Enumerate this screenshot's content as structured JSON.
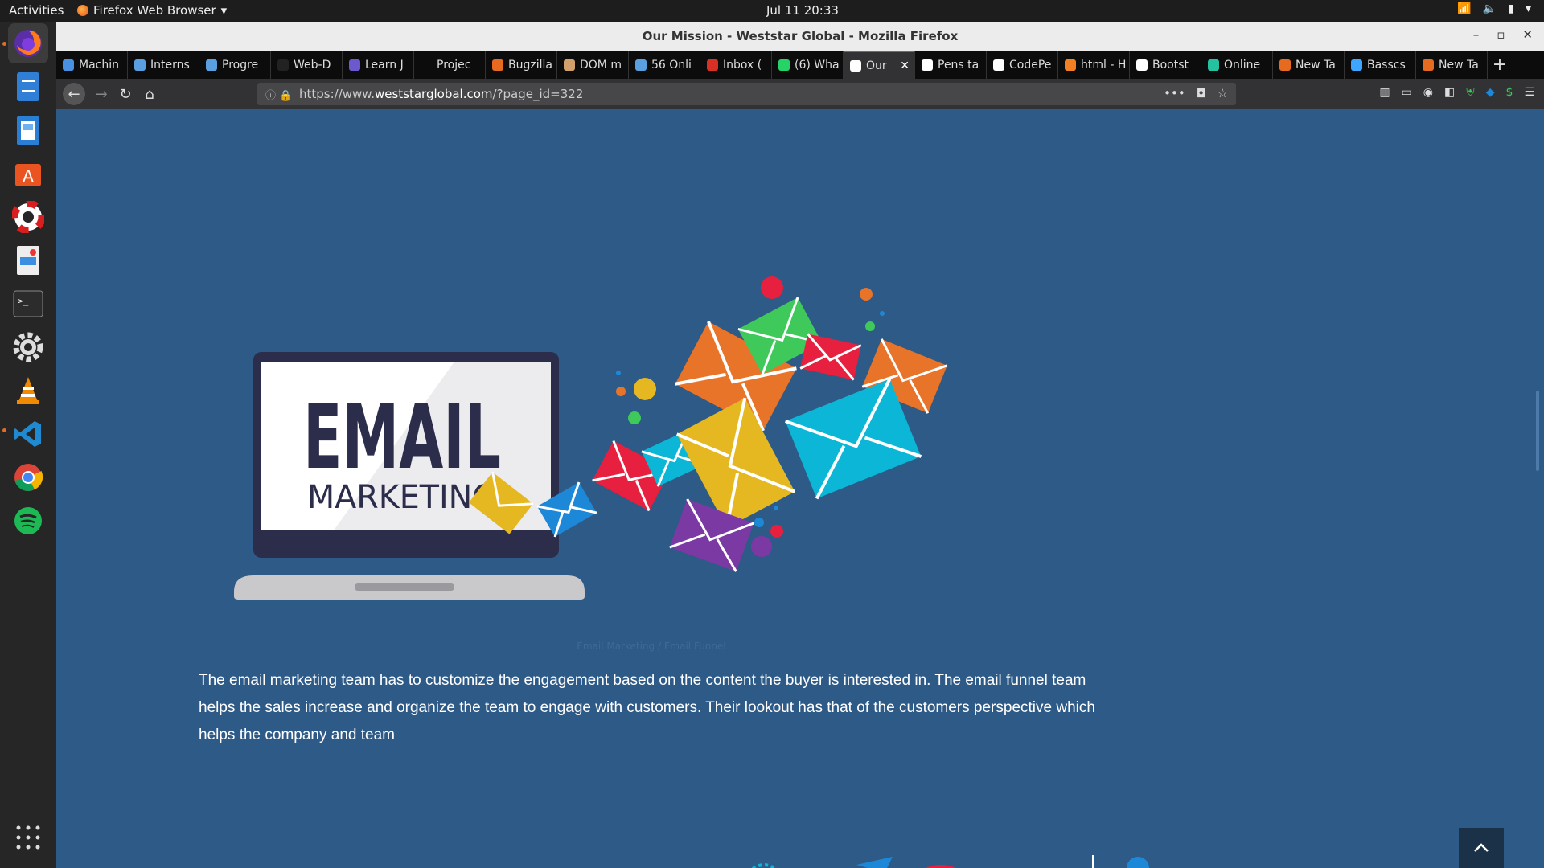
{
  "system": {
    "activities": "Activities",
    "app_name": "Firefox Web Browser",
    "clock": "Jul 11  20:33"
  },
  "window": {
    "title": "Our Mission - Weststar Global - Mozilla Firefox"
  },
  "tabs": [
    {
      "label": "Machin",
      "color": "#4a90e2"
    },
    {
      "label": "Interns",
      "color": "#5aa0e0"
    },
    {
      "label": "Progre",
      "color": "#5aa0e0"
    },
    {
      "label": "Web-D",
      "color": "#222222"
    },
    {
      "label": "Learn J",
      "color": "#6a5acd"
    },
    {
      "label": "Projec",
      "color": "#0c0c0d"
    },
    {
      "label": "Bugzilla",
      "color": "#e66a1f"
    },
    {
      "label": "DOM m",
      "color": "#d2a06a"
    },
    {
      "label": "56 Onli",
      "color": "#5aa0e0"
    },
    {
      "label": "Inbox (",
      "color": "#d93025"
    },
    {
      "label": "(6) Wha",
      "color": "#25d366"
    },
    {
      "label": "Our",
      "color": "#ffffff",
      "active": true
    },
    {
      "label": "Pens ta",
      "color": "#ffffff"
    },
    {
      "label": "CodePe",
      "color": "#ffffff"
    },
    {
      "label": "html - H",
      "color": "#f48024"
    },
    {
      "label": "Bootst",
      "color": "#ffffff"
    },
    {
      "label": "Online",
      "color": "#25c2a0"
    },
    {
      "label": "New Ta",
      "color": "#e66a1f"
    },
    {
      "label": "Basscs",
      "color": "#3ea6ff"
    },
    {
      "label": "New Ta",
      "color": "#e66a1f"
    }
  ],
  "url": {
    "prefix": "https://www.",
    "domain": "weststarglobal.com",
    "suffix": "/?page_id=322"
  },
  "content": {
    "image_title": "EMAIL",
    "image_subtitle": "MARKETING",
    "caption": "Email Marketing / Email Funnel",
    "paragraph": "The email marketing team has to customize the engagement based on the content the buyer is interested in. The email funnel team helps the sales increase and organize the team to engage with customers. Their lookout has that of the customers perspective which helps the company and team"
  },
  "colors": {
    "page_bg": "#2e5a87",
    "laptop_frame": "#2b2d4a",
    "envelope_orange": "#e8742a",
    "envelope_green": "#3ec95a",
    "envelope_red": "#e8203f",
    "envelope_yellow": "#e5b720",
    "envelope_cyan": "#0bb6d6",
    "envelope_purple": "#7b3aa3",
    "envelope_blue": "#1e88d8"
  }
}
